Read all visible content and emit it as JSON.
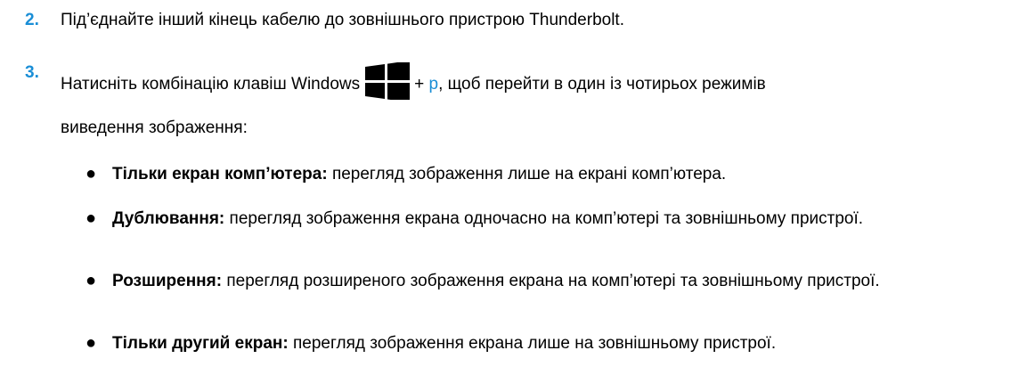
{
  "steps": [
    {
      "number": "2.",
      "text": "Під’єднайте інший кінець кабелю до зовнішнього пристрою Thunderbolt."
    },
    {
      "number": "3.",
      "text_before": "Натисніть комбінацію клавіш Windows",
      "plus": "+",
      "key": "p",
      "text_after": ", щоб перейти в один із чотирьох режимів",
      "continuation": "виведення зображення:"
    }
  ],
  "icons": {
    "windows_key": "windows-logo-icon"
  },
  "modes": [
    {
      "bullet": "●",
      "term": "Тільки екран комп’ютера:",
      "desc": "перегляд зображення лише на екрані комп’ютера."
    },
    {
      "bullet": "●",
      "term": "Дублювання:",
      "desc": "перегляд зображення екрана одночасно на комп’ютері та зовнішньому пристрої."
    },
    {
      "bullet": "●",
      "term": "Розширення:",
      "desc": "перегляд розширеного зображення екрана на комп’ютері та зовнішньому пристрої."
    },
    {
      "bullet": "●",
      "term": "Тільки другий екран:",
      "desc": "перегляд зображення екрана лише на зовнішньому пристрої."
    }
  ],
  "colors": {
    "accent": "#1a8ed6",
    "text": "#000000"
  }
}
